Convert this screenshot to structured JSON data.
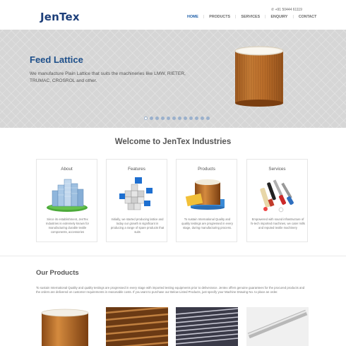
{
  "header": {
    "logo": "JenTex",
    "phone": "+91 50444 61119",
    "nav": [
      "HOME",
      "PRODUCTS",
      "SERVICES",
      "ENQUIRY",
      "CONTACT"
    ],
    "active_nav": "HOME"
  },
  "hero": {
    "title": "Feed Lattice",
    "text": "We manufacture Plain Lattice that suits the machineries like LMW, RIETER, TRUMAC, CROSROL and other.",
    "slide_count": 12,
    "active_slide": 1
  },
  "welcome": {
    "title": "Welcome to JenTex Industries"
  },
  "cards": [
    {
      "title": "About",
      "text": "Since its establishment, JenTex Industries is extremely known for manufacturing durable textile components, accessories",
      "icon": "buildings-icon"
    },
    {
      "title": "Features",
      "text": "Initially, we started producing lattice and today our growth is significant in producing a range of spare products that suits",
      "icon": "cubes-icon"
    },
    {
      "title": "Products",
      "text": "To sustain International Quality and quality testings are progressed in every stage, during manufacturing process.",
      "icon": "lattice-roll-icon"
    },
    {
      "title": "Services",
      "text": "Empowered with sound infrastructure of hi-tech imported machines, we cater mills and reputed textile machinery",
      "icon": "tools-icon"
    }
  ],
  "products": {
    "title": "Our Products",
    "text": "To sustain International Quality and quality testings are progressed in every stage with imported testing equipments prior to deliverance. Jentex offers genuine guarantees for the procured products and the orders are delivered on customer requirements in reasonable costs. If you want to purchase our Below Listed Products, just specify your Machine Drawing No. to place an order."
  },
  "colors": {
    "brand": "#1d3f7a",
    "nav_active": "#1d5ea8",
    "hero_title": "#1d4f8a",
    "lattice_wood": "#c8782e"
  }
}
